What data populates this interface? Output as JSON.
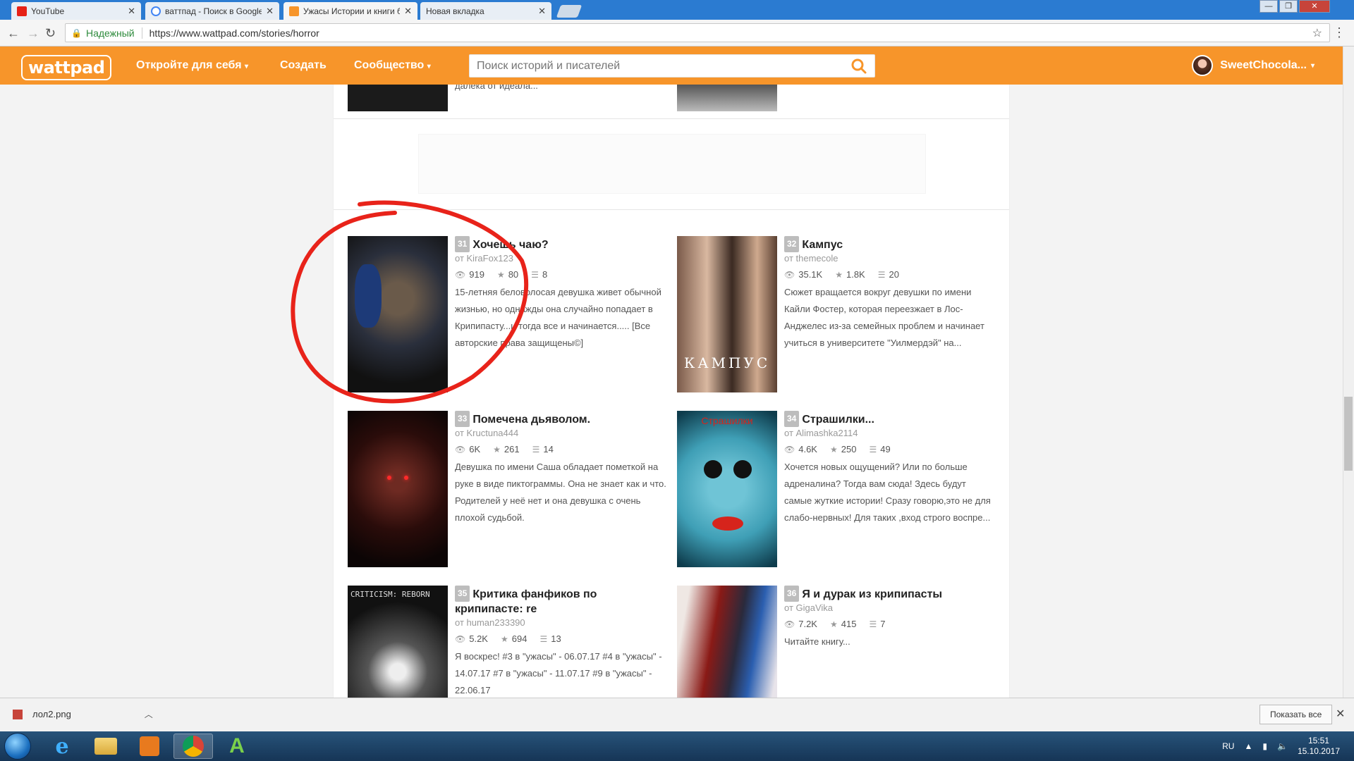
{
  "browser": {
    "tabs": [
      {
        "label": "YouTube",
        "favicon_color": "#e62117",
        "active": false
      },
      {
        "label": "ваттпад - Поиск в Google",
        "favicon_color": "#4285f4",
        "active": false
      },
      {
        "label": "Ужасы Истории и книги б",
        "favicon_color": "#f7952a",
        "active": true
      },
      {
        "label": "Новая вкладка",
        "favicon_color": "",
        "active": false
      }
    ],
    "security_label": "Надежный",
    "url": "https://www.wattpad.com/stories/horror"
  },
  "header": {
    "logo": "wattpad",
    "nav": {
      "discover": "Откройте для себя",
      "create": "Создать",
      "community": "Сообщество"
    },
    "search_placeholder": "Поиск историй и писателей",
    "username": "SweetChocola..."
  },
  "top_partial": {
    "left_desc": "далека от идеала..."
  },
  "stories": [
    {
      "rank": "31",
      "title": "Хочешь чаю?",
      "author": "от KiraFox123",
      "reads": "919",
      "votes": "80",
      "parts": "8",
      "description": "15-летняя беловолосая девушка живет обычной жизнью, но однажды она случайно попадает в Крипипасту...и тогда все и начинается..... [Все авторские права защищены©]",
      "cover_text": ""
    },
    {
      "rank": "32",
      "title": "Кампус",
      "author": "от themecole",
      "reads": "35.1K",
      "votes": "1.8K",
      "parts": "20",
      "description": "Сюжет вращается вокруг девушки по имени Кайли Фостер, которая переезжает в Лос-Анджелес из-за семейных проблем и начинает учиться в университете \"Уилмердэй\" на...",
      "cover_text": "КАМПУС"
    },
    {
      "rank": "33",
      "title": "Помечена дьяволом.",
      "author": "от Kructuna444",
      "reads": "6K",
      "votes": "261",
      "parts": "14",
      "description": "Девушка по имени Саша обладает пометкой на руке в виде пиктограммы. Она не знает как и что. Родителей у неё нет и она девушка с очень плохой судьбой.",
      "cover_text": ""
    },
    {
      "rank": "34",
      "title": "Страшилки...",
      "author": "от Alimashka2114",
      "reads": "4.6K",
      "votes": "250",
      "parts": "49",
      "description": "Хочется новых ощущений? Или по больше адреналина? Тогда вам сюда! Здесь будут самые жуткие истории! Сразу говорю,это не для слабо-нервных! Для таких ,вход строго воспре...",
      "cover_text": "Страшилки"
    },
    {
      "rank": "35",
      "title": "Критика фанфиков по крипипасте: re",
      "author": "от human233390",
      "reads": "5.2K",
      "votes": "694",
      "parts": "13",
      "description": "Я воскрес! #3 в \"ужасы\" - 06.07.17 #4 в \"ужасы\" - 14.07.17 #7 в \"ужасы\" - 11.07.17 #9 в \"ужасы\" - 22.06.17",
      "cover_text": "CRITICISM: REBORN"
    },
    {
      "rank": "36",
      "title": "Я и дурак из крипипасты",
      "author": "от GigaVika",
      "reads": "7.2K",
      "votes": "415",
      "parts": "7",
      "description": "Читайте книгу...",
      "cover_text": ""
    }
  ],
  "downloads": {
    "file_name": "лол2.png",
    "show_all": "Показать все"
  },
  "taskbar": {
    "lang": "RU",
    "time": "15:51",
    "date": "15.10.2017"
  },
  "colors": {
    "brand": "#f7952a",
    "annotation": "#e8231a"
  }
}
